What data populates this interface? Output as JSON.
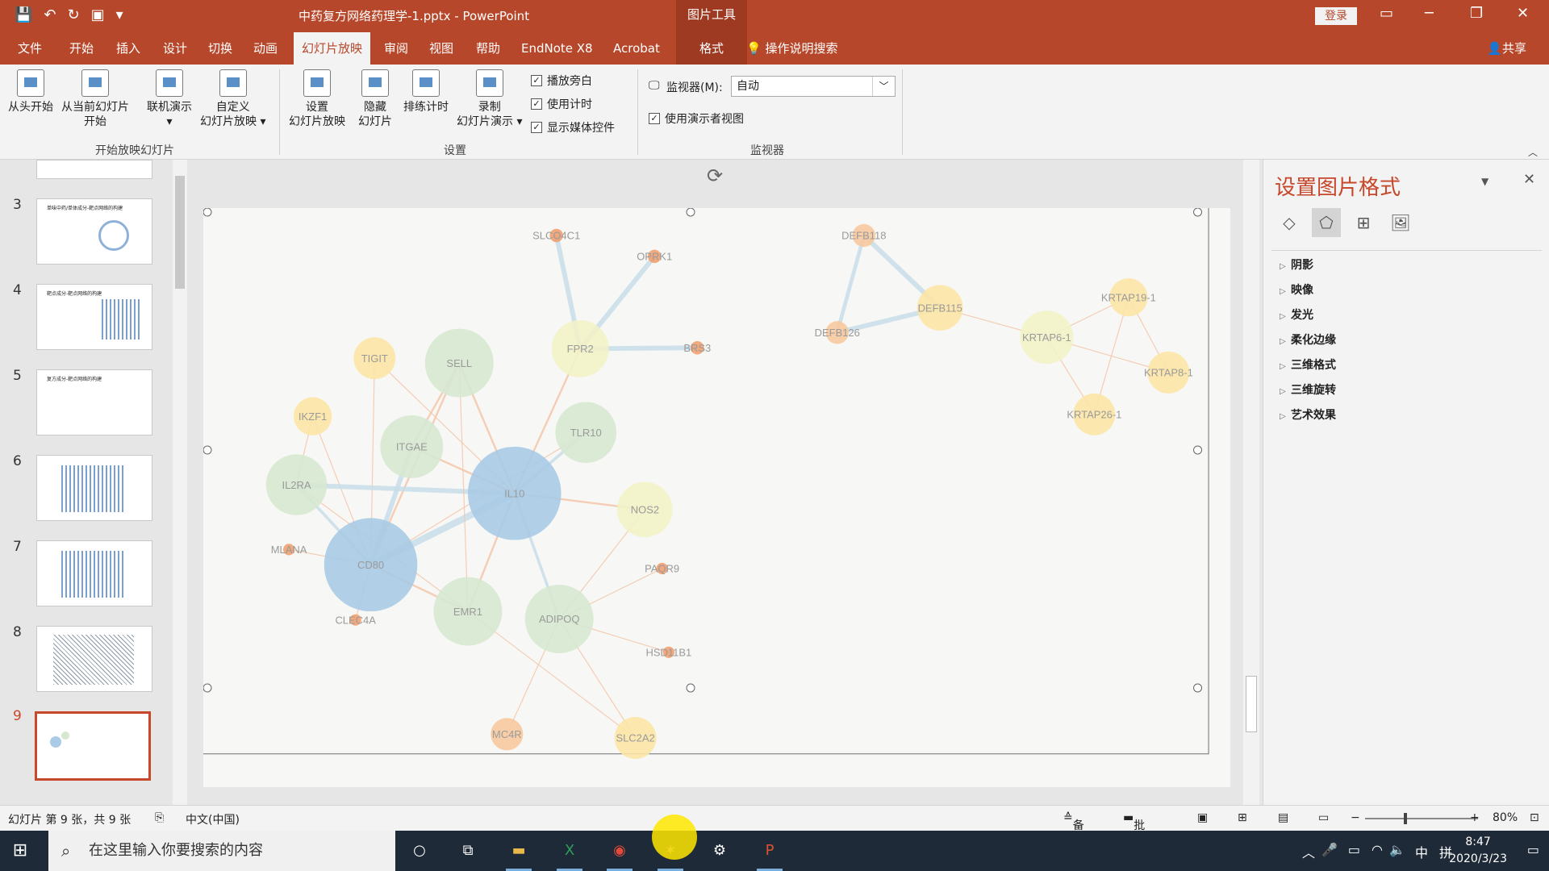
{
  "titlebar": {
    "doc_title": "中药复方网络药理学-1.pptx  -  PowerPoint",
    "context_label": "图片工具",
    "login": "登录",
    "minimize": "─",
    "restore": "❐",
    "close": "✕"
  },
  "tabs": [
    "文件",
    "开始",
    "插入",
    "设计",
    "切换",
    "动画",
    "幻灯片放映",
    "审阅",
    "视图",
    "帮助",
    "EndNote X8",
    "Acrobat",
    "格式"
  ],
  "active_tab": "幻灯片放映",
  "tell_me": "操作说明搜索",
  "share": "共享",
  "ribbon": {
    "from_beginning": "从头开始",
    "from_current_1": "从当前幻灯片",
    "from_current_2": "开始",
    "online_1": "联机演示",
    "online_2": "▾",
    "custom_1": "自定义",
    "custom_2": "幻灯片放映 ▾",
    "group_start": "开始放映幻灯片",
    "setup_1": "设置",
    "setup_2": "幻灯片放映",
    "hide_1": "隐藏",
    "hide_2": "幻灯片",
    "rehearse": "排练计时",
    "record_1": "录制",
    "record_2": "幻灯片演示 ▾",
    "chk_narration": "播放旁白",
    "chk_timing": "使用计时",
    "chk_media": "显示媒体控件",
    "group_setup": "设置",
    "monitor_label": "监视器(M):",
    "monitor_value": "自动",
    "chk_presenter": "使用演示者视图",
    "group_monitor": "监视器"
  },
  "thumbnails": [
    {
      "num": "3",
      "title": "单味中药/单体成分-靶点网络的构建"
    },
    {
      "num": "4",
      "title": "靶点成分-靶点网络的构建"
    },
    {
      "num": "5",
      "title": "复方成分-靶点网络的构建"
    },
    {
      "num": "6",
      "title": ""
    },
    {
      "num": "7",
      "title": ""
    },
    {
      "num": "8",
      "title": ""
    },
    {
      "num": "9",
      "title": ""
    }
  ],
  "network": {
    "nodes": [
      {
        "id": "SLCO4C1",
        "color": "#f0a070"
      },
      {
        "id": "OPRK1",
        "color": "#f0a070"
      },
      {
        "id": "BRS3",
        "color": "#f0a070"
      },
      {
        "id": "FPR2",
        "color": "#f2f2c8"
      },
      {
        "id": "TIGIT",
        "color": "#fce6a6"
      },
      {
        "id": "SELL",
        "color": "#d6e8d2"
      },
      {
        "id": "IKZF1",
        "color": "#fce6a6"
      },
      {
        "id": "ITGAE",
        "color": "#d6e8d2"
      },
      {
        "id": "TLR10",
        "color": "#d6e8d2"
      },
      {
        "id": "IL2RA",
        "color": "#d6e8d2"
      },
      {
        "id": "IL10",
        "color": "#a9cbe6"
      },
      {
        "id": "NOS2",
        "color": "#f2f2c8"
      },
      {
        "id": "MLANA",
        "color": "#f0a070"
      },
      {
        "id": "CD80",
        "color": "#a9cbe6"
      },
      {
        "id": "PAQR9",
        "color": "#f0a070"
      },
      {
        "id": "CLEC4A",
        "color": "#f0a070"
      },
      {
        "id": "EMR1",
        "color": "#d6e8d2"
      },
      {
        "id": "ADIPOQ",
        "color": "#d6e8d2"
      },
      {
        "id": "HSD11B1",
        "color": "#f0a070"
      },
      {
        "id": "MC4R",
        "color": "#f7c9a0"
      },
      {
        "id": "SLC2A2",
        "color": "#fce6a6"
      },
      {
        "id": "DEFB118",
        "color": "#f7c9a0"
      },
      {
        "id": "DEFB115",
        "color": "#fce6a6"
      },
      {
        "id": "DEFB126",
        "color": "#f7c9a0"
      },
      {
        "id": "KRTAP19-1",
        "color": "#fce6a6"
      },
      {
        "id": "KRTAP6-1",
        "color": "#f2f2c8"
      },
      {
        "id": "KRTAP8-1",
        "color": "#fce6a6"
      },
      {
        "id": "KRTAP26-1",
        "color": "#fce6a6"
      }
    ]
  },
  "format_pane": {
    "title": "设置图片格式",
    "items": [
      "阴影",
      "映像",
      "发光",
      "柔化边缘",
      "三维格式",
      "三维旋转",
      "艺术效果"
    ]
  },
  "statusbar": {
    "slide_info": "幻灯片 第 9 张，共 9 张",
    "language": "中文(中国)",
    "notes": "备注",
    "comments": "批注",
    "zoom": "80%"
  },
  "taskbar": {
    "search_placeholder": "在这里输入你要搜索的内容",
    "ime": "中",
    "layout": "拼",
    "time": "8:47",
    "date": "2020/3/23"
  }
}
